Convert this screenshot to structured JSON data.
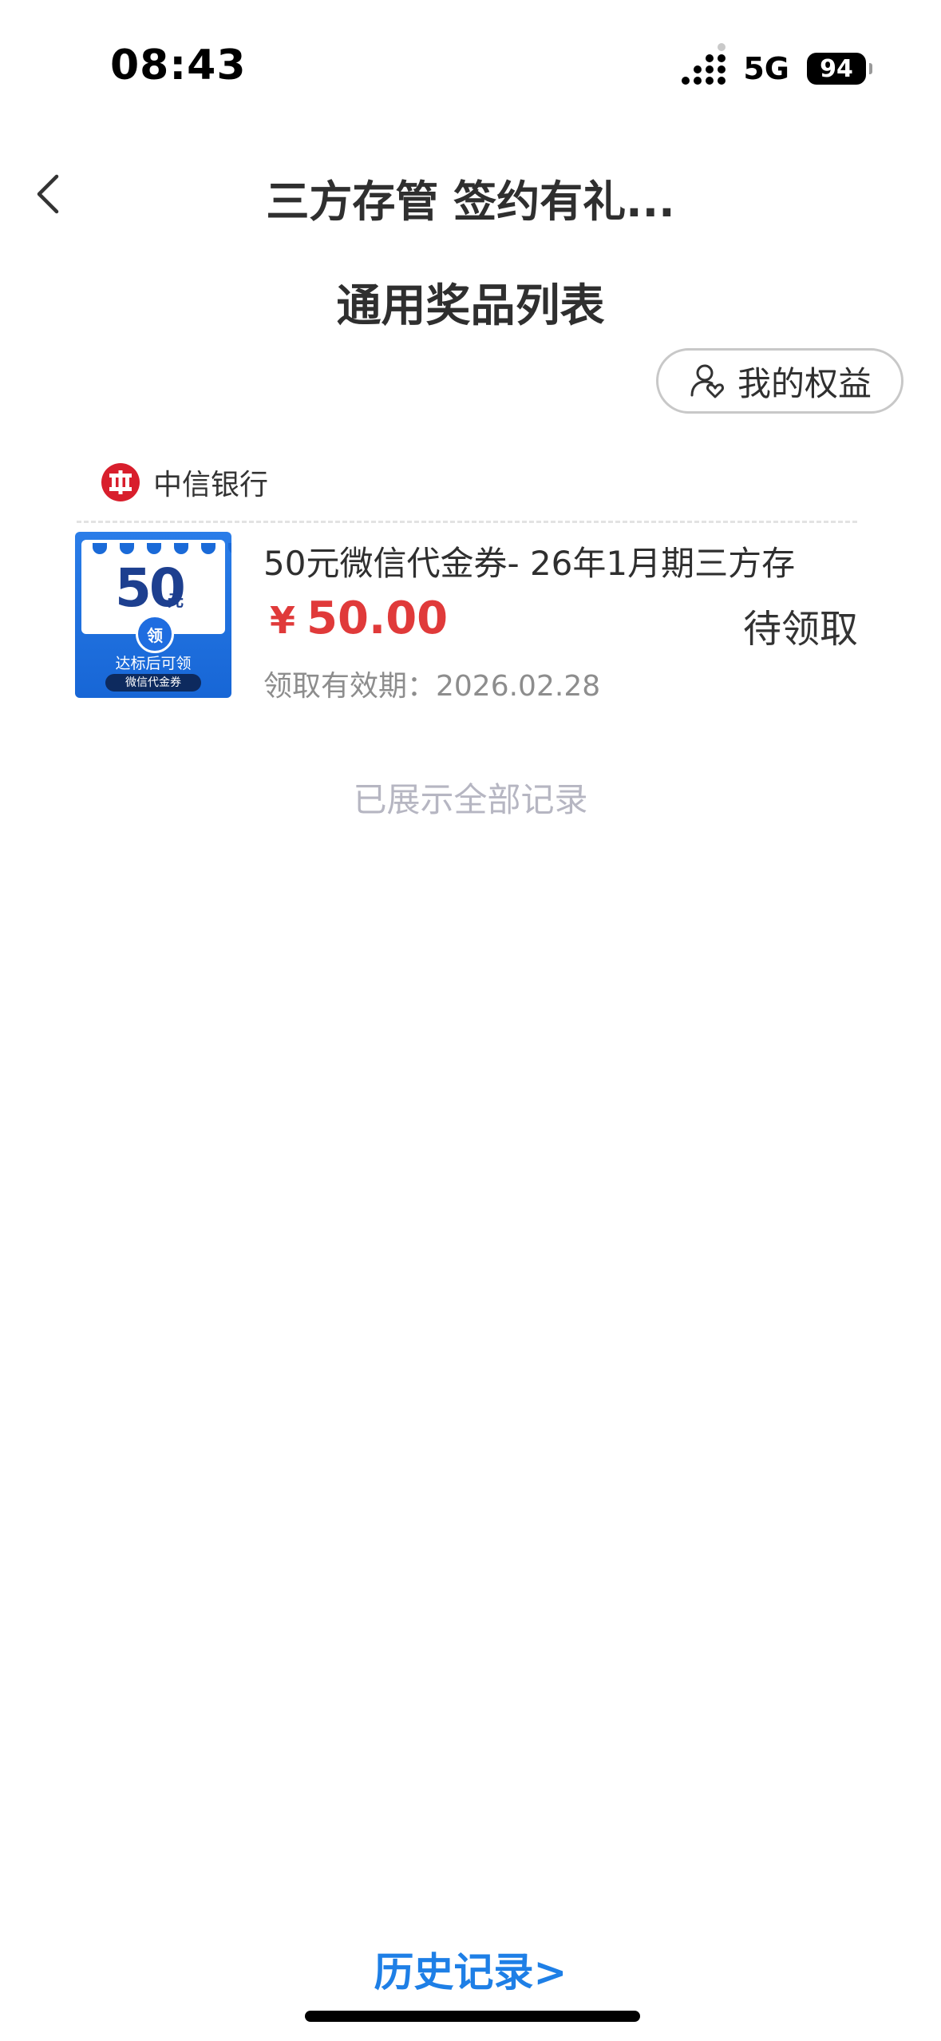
{
  "status_bar": {
    "time": "08:43",
    "network": "5G",
    "battery": "94"
  },
  "nav": {
    "title": "三方存管 签约有礼..."
  },
  "section": {
    "title": "通用奖品列表"
  },
  "rights_button": {
    "label": "我的权益"
  },
  "bank": {
    "name": "中信银行",
    "logo_color": "#d81e2c"
  },
  "prize": {
    "name": "50元微信代金券- 26年1月期三方存",
    "currency": "¥",
    "price": "50.00",
    "status": "待领取",
    "expiry": "领取有效期：2026.02.28",
    "thumbnail": {
      "amount": "50",
      "unit": "元",
      "seal": "领",
      "caption": "达标后可领",
      "tag": "微信代金券"
    }
  },
  "end_note": "已展示全部记录",
  "history_link": "历史记录>",
  "colors": {
    "price_red": "#e03a3a",
    "link_blue": "#1e7fe6",
    "coupon_blue": "#1766d6"
  }
}
